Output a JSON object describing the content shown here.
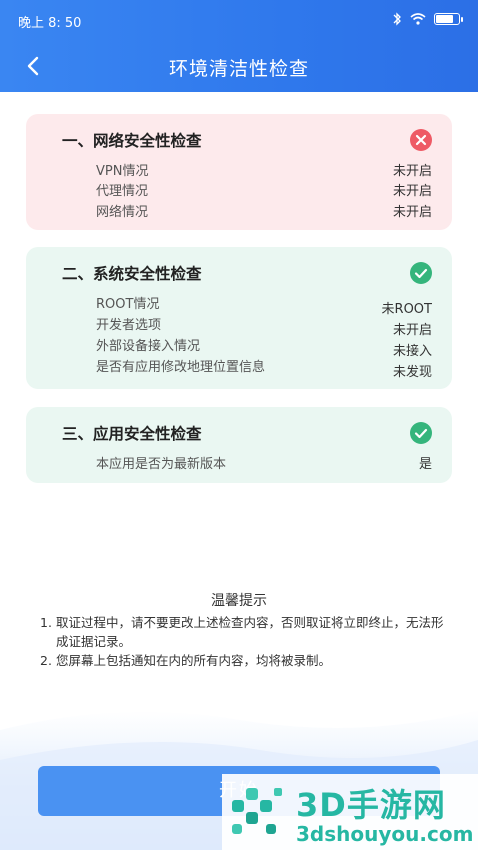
{
  "status_bar": {
    "time": "晚上 8: 50",
    "battery_level": 0.85
  },
  "nav": {
    "title": "环境清洁性检查",
    "back_icon": "chevron-left-icon"
  },
  "sections": [
    {
      "title": "一、网络安全性检查",
      "status": "fail",
      "rows": [
        {
          "label": "VPN情况",
          "value": "未开启"
        },
        {
          "label": "代理情况",
          "value": "未开启"
        },
        {
          "label": "网络情况",
          "value": "未开启"
        }
      ]
    },
    {
      "title": "二、系统安全性检查",
      "status": "pass",
      "rows": [
        {
          "label": "ROOT情况",
          "value": "未ROOT"
        },
        {
          "label": "开发者选项",
          "value": "未开启"
        },
        {
          "label": "外部设备接入情况",
          "value": "未接入"
        },
        {
          "label": "是否有应用修改地理位置信息",
          "value": "未发现"
        }
      ]
    },
    {
      "title": "三、应用安全性检查",
      "status": "pass",
      "rows": [
        {
          "label": "本应用是否为最新版本",
          "value": "是"
        }
      ]
    }
  ],
  "tips": {
    "title": "温馨提示",
    "items": [
      {
        "num": "1.",
        "text": "取证过程中，请不要更改上述检查内容，否则取证将立即终止，无法形成证据记录。"
      },
      {
        "num": "2.",
        "text": "您屏幕上包括通知在内的所有内容，均将被录制。"
      }
    ]
  },
  "start_button": {
    "label": "开始"
  },
  "watermark": {
    "name": "3D手游网",
    "url": "3dshouyou.com"
  },
  "colors": {
    "header": "#2f78ec",
    "fail": "#ee5a65",
    "pass": "#35b57c",
    "button": "#4a92f2",
    "watermark": "#26b7a3"
  }
}
